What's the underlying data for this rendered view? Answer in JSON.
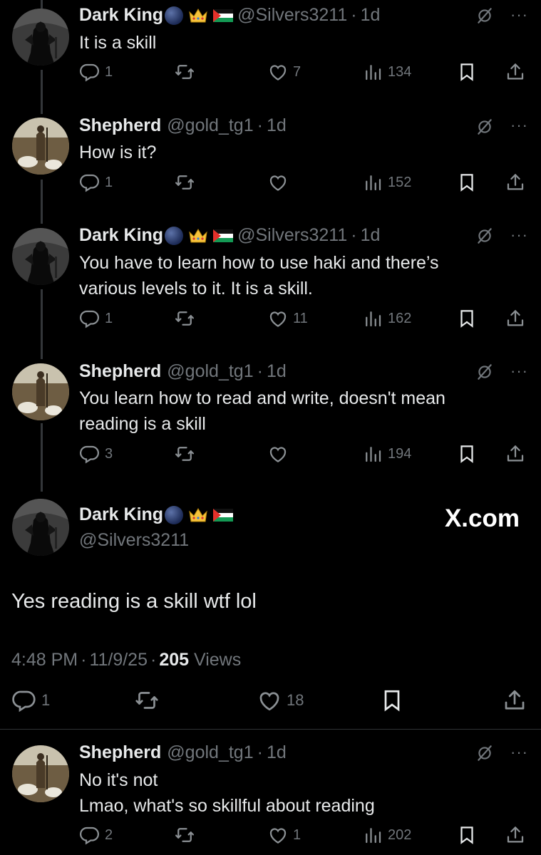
{
  "replies": [
    {
      "name": "Dark King",
      "handle": "@Silvers3211",
      "time": "1d",
      "text": "It is a skill",
      "replies_count": "1",
      "likes": "7",
      "views": "134",
      "badges": [
        "globe",
        "crown",
        "palestine-flag"
      ]
    },
    {
      "name": "Shepherd",
      "handle": "@gold_tg1",
      "time": "1d",
      "text": "How is it?",
      "replies_count": "1",
      "likes": "",
      "views": "152"
    },
    {
      "name": "Dark King",
      "handle": "@Silvers3211",
      "time": "1d",
      "text_lines": [
        "You have to learn how to use haki and there’s",
        "various levels to it. It is a skill."
      ],
      "replies_count": "1",
      "likes": "11",
      "views": "162",
      "badges": [
        "globe",
        "crown",
        "palestine-flag"
      ]
    },
    {
      "name": "Shepherd",
      "handle": "@gold_tg1",
      "time": "1d",
      "text_lines": [
        "You learn how to read and write, doesn't mean",
        "reading is a skill"
      ],
      "replies_count": "3",
      "likes": "",
      "views": "194"
    }
  ],
  "main_post": {
    "name": "Dark King",
    "handle": "@Silvers3211",
    "text": "Yes reading is a skill wtf lol",
    "time": "4:48 PM",
    "date": "11/9/25",
    "views_count": "205",
    "views_label": "Views",
    "replies_count": "1",
    "likes": "18",
    "watermark": "X.com"
  },
  "last_reply": {
    "name": "Shepherd",
    "handle": "@gold_tg1",
    "time": "1d",
    "text_lines": [
      "No it's not",
      "Lmao, what's so skillful about reading"
    ],
    "replies_count": "2",
    "likes": "1",
    "views": "202"
  },
  "ui": {
    "dot": "·",
    "more": "···"
  },
  "colors": {
    "background": "#000000",
    "text": "#e7e9ea",
    "muted": "#71767b",
    "divider": "#2f3336"
  }
}
